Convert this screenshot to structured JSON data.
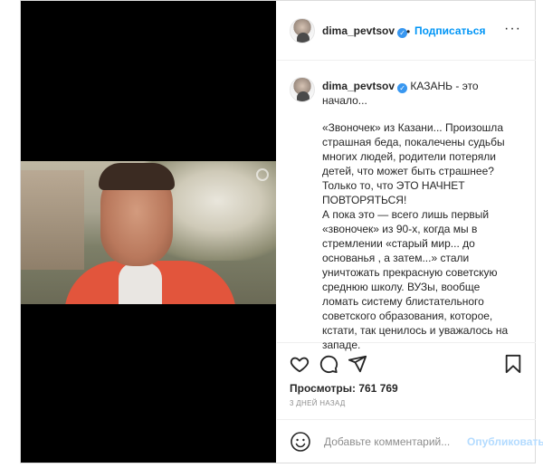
{
  "post": {
    "username": "dima_pevtsov",
    "dot": "•",
    "follow_label": "Подписаться",
    "more_label": "···",
    "caption_head": "КАЗАНЬ - это начало...",
    "caption_lines": [
      "«Звоночек» из Казани... Произошла",
      "страшная беда, покалечены судьбы",
      "многих людей, родители потеряли",
      "детей, что может быть страшнее?",
      "Только то, что ЭТО НАЧНЕТ",
      "ПОВТОРЯТЬСЯ!",
      "А пока это — всего лишь  первый",
      "«звоночек» из 90-х, когда мы в",
      "стремлении «старый мир... до",
      "основанья , а затем...» стали",
      "уничтожать прекрасную советскую",
      "среднюю школу. ВУЗы, вообще",
      "ломать систему блистательного",
      " советского образования, которое,",
      "кстати, так ценилось и уважалось на",
      "западе."
    ],
    "views_label": "Просмотры: 761 769",
    "date": "3 дней назад"
  },
  "comment": {
    "placeholder": "Добавьте комментарий...",
    "publish_label": "Опубликовать"
  },
  "icons": {
    "like": "heart-icon",
    "comment": "comment-icon",
    "share": "share-icon",
    "save": "bookmark-icon",
    "emoji": "smiley-icon",
    "verified": "verified-badge-icon"
  },
  "colors": {
    "accent": "#0095f6",
    "verified": "#3897f0",
    "publish_disabled": "#b3dbff",
    "muted": "#8e8e8e"
  }
}
